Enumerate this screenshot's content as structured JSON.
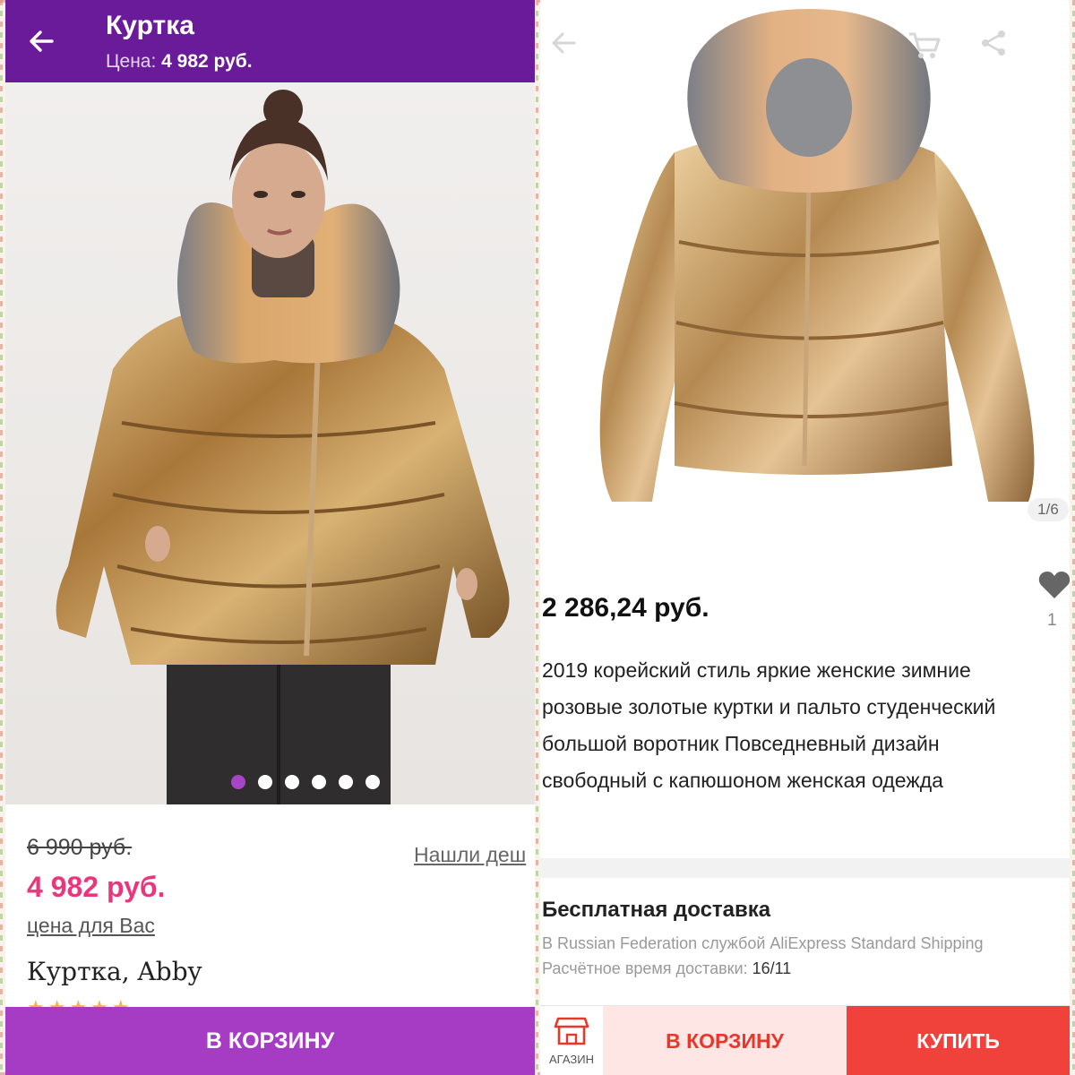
{
  "left": {
    "header": {
      "title": "Куртка",
      "price_label": "Цена:",
      "price_value": "4 982 руб."
    },
    "gallery": {
      "dots": 6,
      "active_index": 0
    },
    "old_price": "6 990 руб.",
    "found_cheaper": "Нашли деш",
    "new_price": "4 982 руб.",
    "price_for_you": "цена для Вас",
    "product_name": "Куртка, Abby",
    "stars": "★★★★★",
    "cart_button": "В КОРЗИНУ",
    "colors": {
      "header": "#6a1b9a",
      "price": "#e8377c",
      "cart": "#a63cc4",
      "dot_active": "#a844c8"
    }
  },
  "right": {
    "image_counter": "1/6",
    "price": "2 286,24 руб.",
    "likes": "1",
    "description": "2019 корейский стиль яркие женские зимние розовые золотые куртки и пальто студенческий большой воротник Повседневный дизайн свободный с капюшоном женская одежда",
    "shipping": {
      "title": "Бесплатная доставка",
      "line": "В Russian Federation службой AliExpress Standard Shipping",
      "eta_label": "Расчётное время доставки:",
      "eta_value": "16/11"
    },
    "bottom": {
      "store_label": "АГАЗИН",
      "cart_button": "В КОРЗИНУ",
      "buy_button": "КУПИТЬ"
    },
    "icons": [
      "back-arrow-icon",
      "cart-icon",
      "share-icon",
      "heart-icon",
      "store-icon"
    ],
    "colors": {
      "buy": "#f0413a",
      "cart_bg": "#fde6e4",
      "cart_text": "#e8372b"
    }
  }
}
